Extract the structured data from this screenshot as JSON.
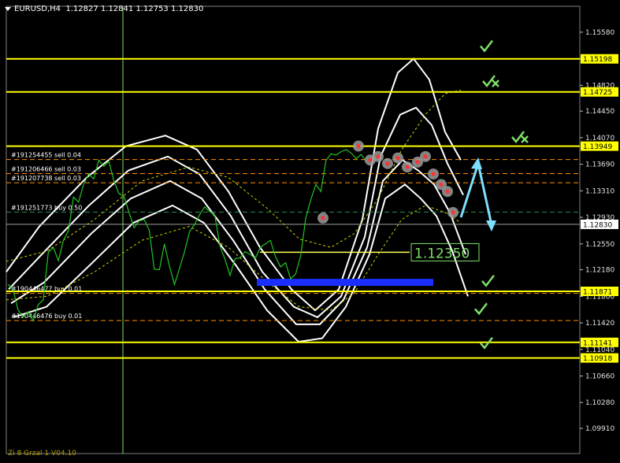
{
  "header": {
    "symbol": "EURUSD,H4",
    "ohlc": "1.12827 1.12841 1.12753 1.12830"
  },
  "footer_text": "Zi 8 Grzal 1 V04.10",
  "chart_data": {
    "type": "line",
    "title": "EURUSD,H4",
    "ylim": [
      1.0955,
      1.1595
    ],
    "y_ticks": [
      "1.15580",
      "1.15200",
      "1.14820",
      "1.14450",
      "1.14070",
      "1.13690",
      "1.13310",
      "1.12930",
      "1.12550",
      "1.12180",
      "1.11800",
      "1.11420",
      "1.11040",
      "1.10660",
      "1.10280",
      "1.09910"
    ],
    "current_price": "1.12830",
    "target_label": "1.12350",
    "horizontal_levels": [
      {
        "price": 1.15198,
        "label": "1.15198",
        "color": "#ffff00"
      },
      {
        "price": 1.14725,
        "label": "1.14725",
        "color": "#ffff00"
      },
      {
        "price": 1.13949,
        "label": "1.13949",
        "color": "#ffff00"
      },
      {
        "price": 1.11871,
        "label": "1.11871",
        "color": "#ffff00"
      },
      {
        "price": 1.11141,
        "label": "1.11141",
        "color": "#ffff00"
      },
      {
        "price": 1.10918,
        "label": "1.10918",
        "color": "#ffff00"
      }
    ],
    "orders": [
      {
        "price": 1.13757,
        "label": "#191254455 sell 0.04",
        "color": "#ff8c00"
      },
      {
        "price": 1.13555,
        "label": "#191206466 sell 0.03",
        "color": "#ff8c00"
      },
      {
        "price": 1.13425,
        "label": "#191207738 sell 0.03",
        "color": "#ff8c00"
      },
      {
        "price": 1.13005,
        "label": "#191251773 buy 0.50",
        "color": "#2e8b57"
      },
      {
        "price": 1.11841,
        "label": "#190446477 buy 0.01",
        "color": "#ff8c00"
      },
      {
        "price": 1.11453,
        "label": "#190446476 buy 0.01",
        "color": "#ff8c00"
      }
    ],
    "series": [
      {
        "values": [
          1.1197,
          1.119,
          1.1161,
          1.115,
          1.1158,
          1.1145,
          1.1168,
          1.1175,
          1.1243,
          1.125,
          1.1231,
          1.126,
          1.1274,
          1.1322,
          1.1315,
          1.134,
          1.1355,
          1.1348,
          1.1375,
          1.1366,
          1.1373,
          1.1345,
          1.1327,
          1.1323,
          1.13,
          1.1278,
          1.1288,
          1.129,
          1.1275,
          1.1219,
          1.1218,
          1.1255,
          1.1223,
          1.1197,
          1.122,
          1.1244,
          1.1273,
          1.1283,
          1.1297,
          1.1308,
          1.1301,
          1.1296,
          1.1252,
          1.1233,
          1.121,
          1.1234,
          1.1235,
          1.1244,
          1.124,
          1.1234,
          1.125,
          1.1255,
          1.126,
          1.1237,
          1.1222,
          1.1228,
          1.1205,
          1.1212,
          1.1238,
          1.1292,
          1.1318,
          1.134,
          1.133,
          1.1374,
          1.1384,
          1.1382,
          1.1387,
          1.139,
          1.1385,
          1.1377,
          1.1383,
          1.1372
        ]
      }
    ],
    "bands": [
      {
        "values": [
          1.1215,
          1.128,
          1.135,
          1.1395,
          1.141,
          1.139,
          1.133,
          1.125,
          1.119,
          1.116,
          1.119,
          1.129,
          1.142,
          1.15,
          1.152,
          1.149,
          1.1415,
          1.1375
        ]
      },
      {
        "values": [
          1.119,
          1.124,
          1.131,
          1.136,
          1.138,
          1.1355,
          1.1295,
          1.1215,
          1.1165,
          1.115,
          1.118,
          1.1265,
          1.138,
          1.144,
          1.145,
          1.1425,
          1.137,
          1.1325
        ]
      },
      {
        "values": [
          1.117,
          1.12,
          1.127,
          1.132,
          1.1345,
          1.132,
          1.126,
          1.119,
          1.114,
          1.114,
          1.1175,
          1.125,
          1.1345,
          1.1375,
          1.136,
          1.134,
          1.13,
          1.124
        ]
      },
      {
        "values": [
          1.115,
          1.1165,
          1.123,
          1.1285,
          1.131,
          1.1285,
          1.1225,
          1.116,
          1.1115,
          1.112,
          1.1165,
          1.124,
          1.132,
          1.134,
          1.132,
          1.1295,
          1.1245,
          1.118
        ]
      }
    ],
    "forecast": [
      1.1293,
      1.137,
      1.1282
    ],
    "blue_zone": [
      1.1205,
      1.1195
    ],
    "markers": [
      "check-icon",
      "check-x-icon",
      "check-x-icon",
      "check-icon",
      "check-icon",
      "check-icon"
    ]
  }
}
